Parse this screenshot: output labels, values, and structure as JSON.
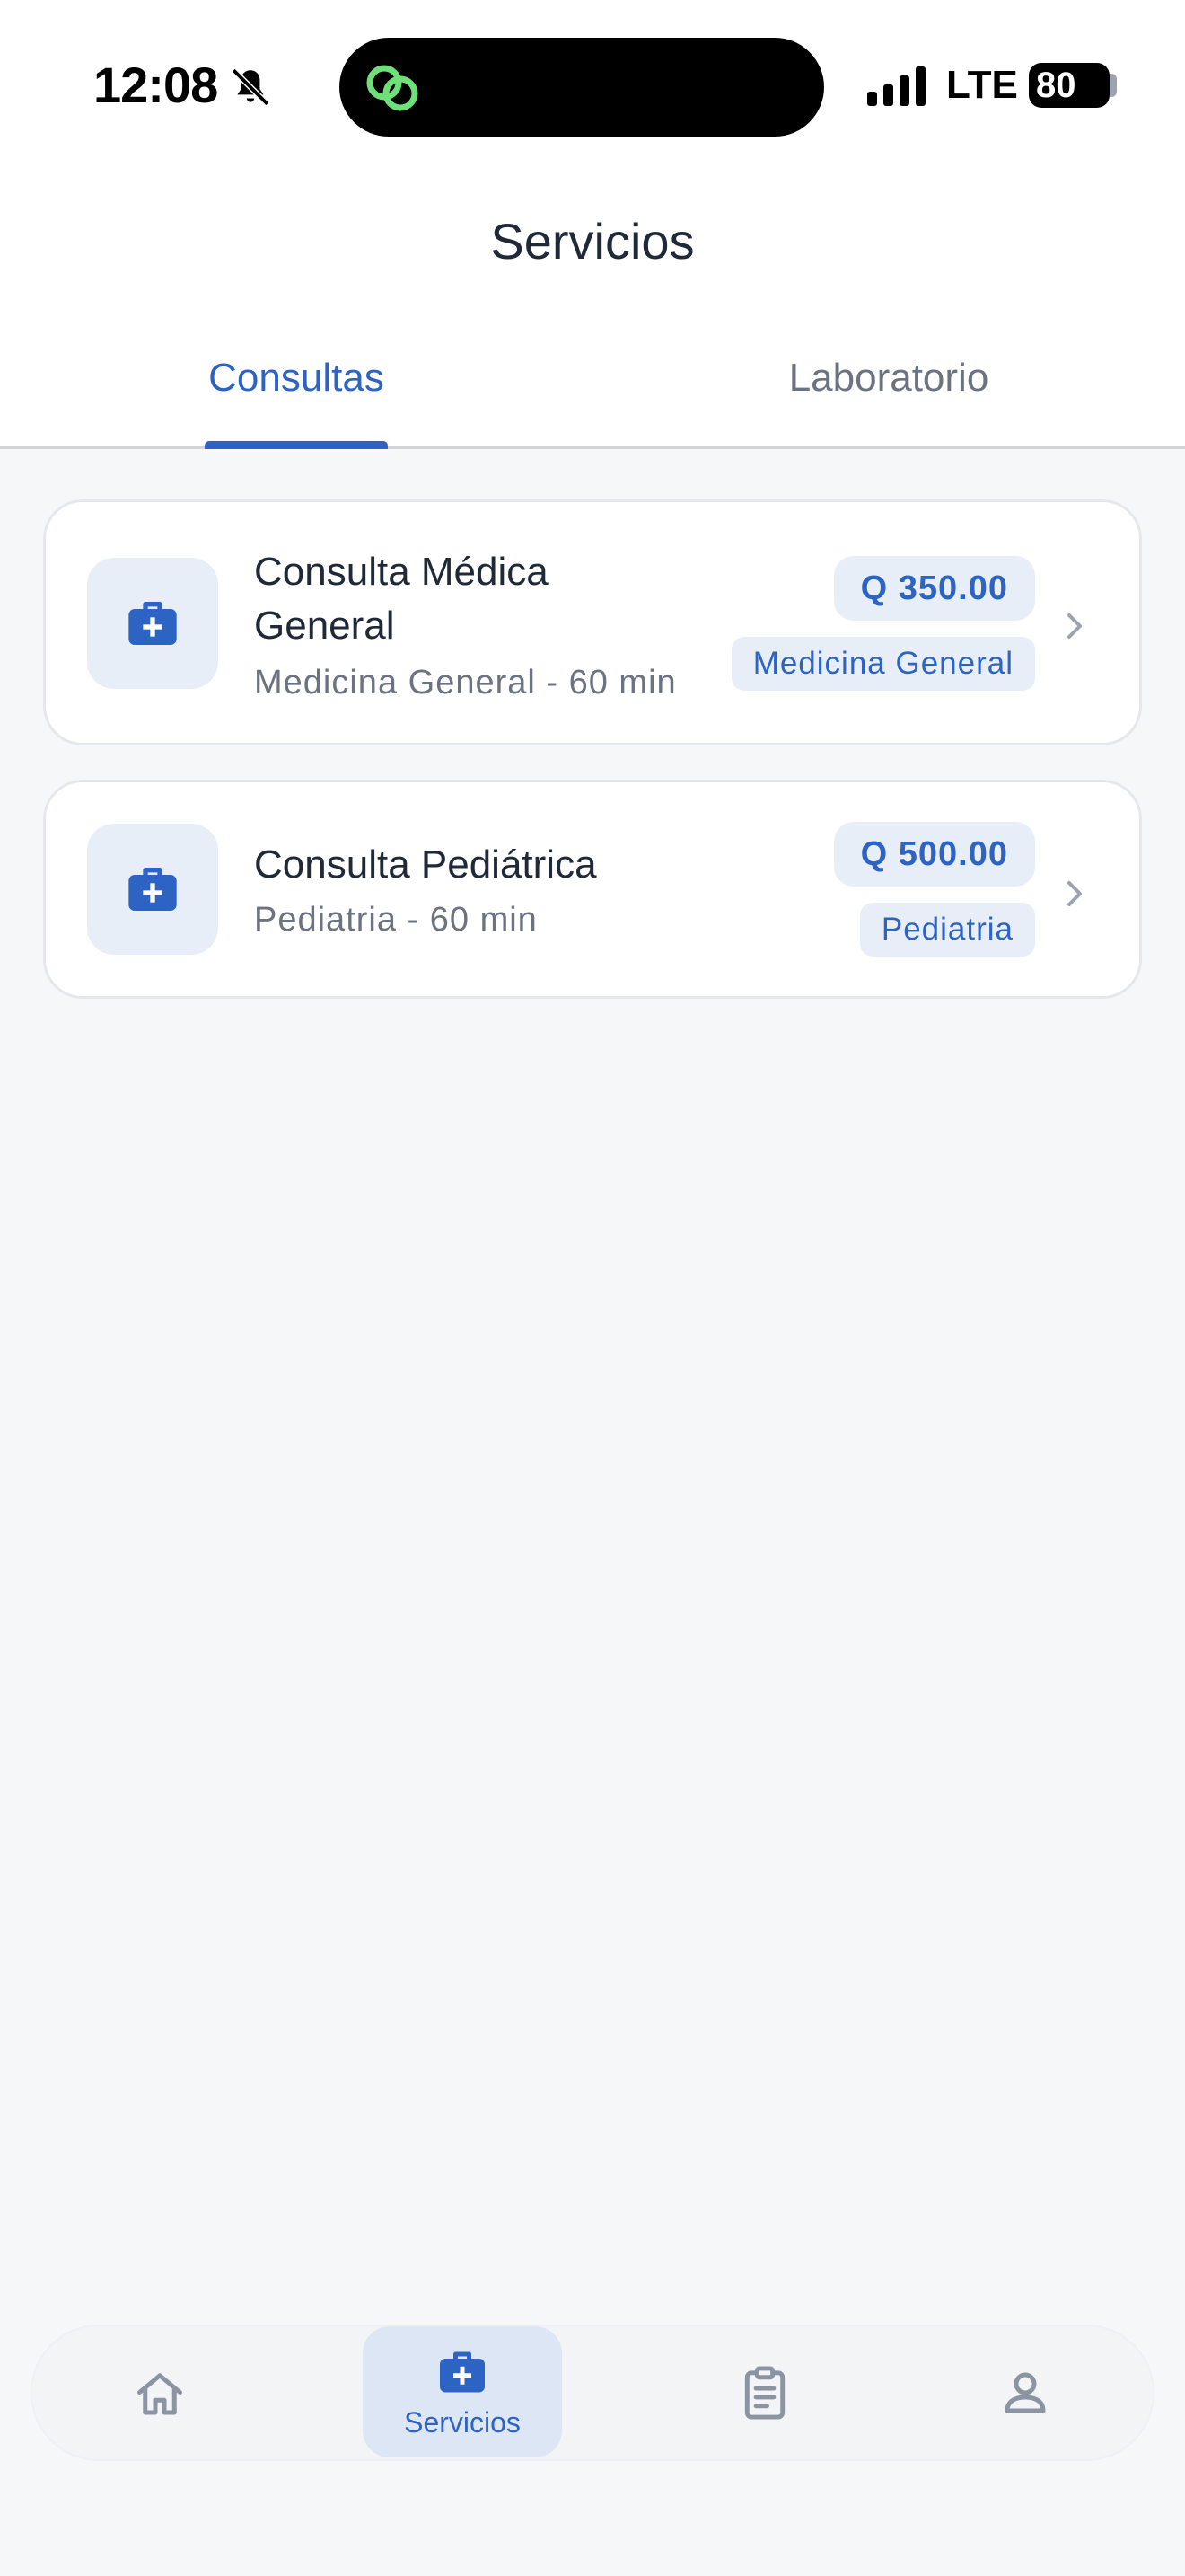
{
  "status_bar": {
    "time": "12:08",
    "network": "LTE",
    "battery": "80"
  },
  "header": {
    "title": "Servicios"
  },
  "tabs": [
    {
      "label": "Consultas",
      "active": true
    },
    {
      "label": "Laboratorio",
      "active": false
    }
  ],
  "services": [
    {
      "title": "Consulta Médica General",
      "subtitle": "Medicina General - 60 min",
      "price": "Q 350.00",
      "category": "Medicina General",
      "icon": "medical-briefcase-icon"
    },
    {
      "title": "Consulta Pediátrica",
      "subtitle": "Pediatria - 60 min",
      "price": "Q 500.00",
      "category": "Pediatria",
      "icon": "medical-briefcase-icon"
    }
  ],
  "bottom_nav": {
    "items": [
      {
        "icon": "home-icon",
        "active": false
      },
      {
        "icon": "medical-briefcase-icon",
        "label": "Servicios",
        "active": true
      },
      {
        "icon": "clipboard-icon",
        "active": false
      },
      {
        "icon": "profile-icon",
        "active": false
      }
    ]
  },
  "colors": {
    "accent": "#2d64c4",
    "badge_bg": "#e8eef8",
    "page_bg": "#f6f7f9",
    "muted_text": "#6b7280"
  }
}
